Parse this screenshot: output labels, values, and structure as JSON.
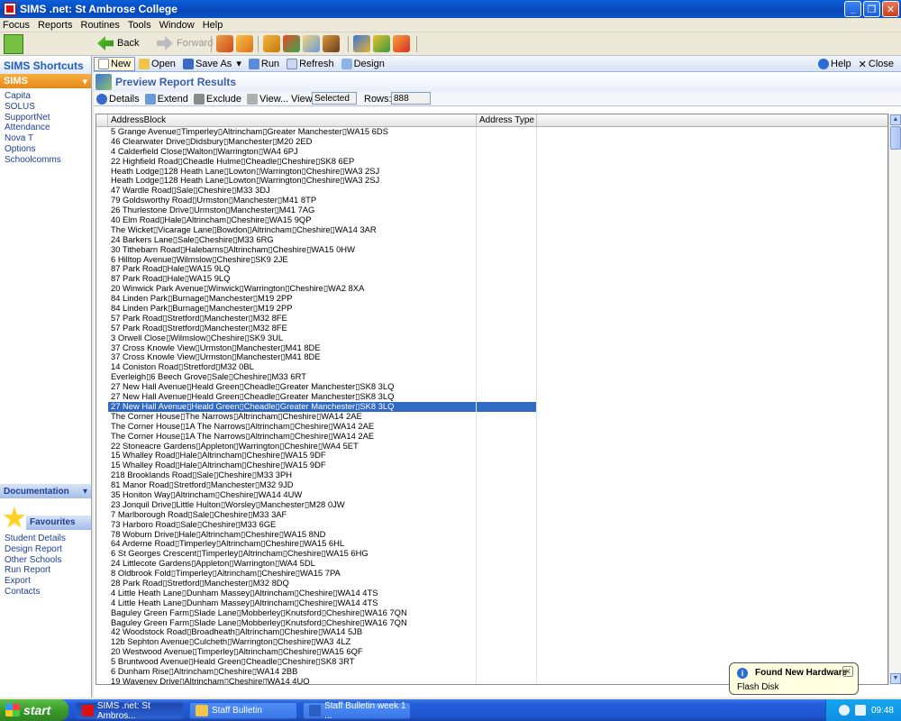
{
  "window": {
    "title": "SIMS .net: St Ambrose College"
  },
  "menu": [
    "Focus",
    "Reports",
    "Routines",
    "Tools",
    "Window",
    "Help"
  ],
  "toolbar": {
    "back": "Back",
    "forward": "Forward"
  },
  "sidebar": {
    "shortcuts_title": "SIMS Shortcuts",
    "group": "SIMS",
    "links": [
      "Capita",
      "SOLUS",
      "SupportNet",
      "Attendance",
      "Nova T",
      "Options",
      "Schoolcomms"
    ],
    "documentation": "Documentation",
    "favourites": "Favourites",
    "favourite_links": [
      "Student Details",
      "Design Report",
      "Other Schools",
      "Run Report",
      "Export",
      "Contacts"
    ]
  },
  "commands": {
    "new": "New",
    "open": "Open",
    "save_as": "Save As",
    "run": "Run",
    "refresh": "Refresh",
    "design": "Design",
    "help": "Help",
    "close": "Close"
  },
  "report": {
    "title": "Preview Report Results",
    "details": "Details",
    "extend": "Extend",
    "exclude": "Exclude",
    "view_menu": "View...",
    "view_label": "View:",
    "view_value": "Selected",
    "rows_label": "Rows:",
    "rows_value": "888"
  },
  "grid": {
    "columns": [
      "AddressBlock",
      "Address Type"
    ],
    "selected_index": 28,
    "rows": [
      "5 Grange Avenue▯Timperley▯Altrincham▯Greater Manchester▯WA15 6DS",
      "46 Clearwater Drive▯Didsbury▯Manchester▯M20 2ED",
      "4 Calderfield Close▯Walton▯Warrington▯WA4 6PJ",
      "22 Highfield Road▯Cheadle Hulme▯Cheadle▯Cheshire▯SK8 6EP",
      "Heath Lodge▯128 Heath Lane▯Lowton▯Warrington▯Cheshire▯WA3 2SJ",
      "Heath Lodge▯128 Heath Lane▯Lowton▯Warrington▯Cheshire▯WA3 2SJ",
      "47 Wardle Road▯Sale▯Cheshire▯M33 3DJ",
      "79 Goldsworthy Road▯Urmston▯Manchester▯M41 8TP",
      "26 Thurlestone Drive▯Urmston▯Manchester▯M41 7AG",
      "40 Elm Road▯Hale▯Altrincham▯Cheshire▯WA15 9QP",
      "The Wicket▯Vicarage Lane▯Bowdon▯Altrincham▯Cheshire▯WA14 3AR",
      "24 Barkers Lane▯Sale▯Cheshire▯M33 6RG",
      "30 Tithebarn Road▯Halebarns▯Altrincham▯Cheshire▯WA15 0HW",
      "6 Hilltop Avenue▯Wilmslow▯Cheshire▯SK9 2JE",
      "87 Park Road▯Hale▯WA15 9LQ",
      "87 Park Road▯Hale▯WA15 9LQ",
      "20 Winwick Park Avenue▯Winwick▯Warrington▯Cheshire▯WA2 8XA",
      "84 Linden Park▯Burnage▯Manchester▯M19 2PP",
      "84 Linden Park▯Burnage▯Manchester▯M19 2PP",
      "57 Park Road▯Stretford▯Manchester▯M32 8FE",
      "57 Park Road▯Stretford▯Manchester▯M32 8FE",
      "3 Orwell Close▯Wilmslow▯Cheshire▯SK9 3UL",
      "37 Cross Knowle View▯Urmston▯Manchester▯M41 8DE",
      "37 Cross Knowle View▯Urmston▯Manchester▯M41 8DE",
      "14 Coniston Road▯Stretford▯M32 0BL",
      "Everleigh▯6 Beech Grove▯Sale▯Cheshire▯M33 6RT",
      "27 New Hall Avenue▯Heald Green▯Cheadle▯Greater Manchester▯SK8 3LQ",
      "27 New Hall Avenue▯Heald Green▯Cheadle▯Greater Manchester▯SK8 3LQ",
      "27 New Hall Avenue▯Heald Green▯Cheadle▯Greater Manchester▯SK8 3LQ",
      "The Corner House▯The Narrows▯Altrincham▯Cheshire▯WA14 2AE",
      "The Corner House▯1A The Narrows▯Altrincham▯Cheshire▯WA14 2AE",
      "The Corner House▯1A The Narrows▯Altrincham▯Cheshire▯WA14 2AE",
      "22 Stoneacre Gardens▯Appleton▯Warrington▯Cheshire▯WA4 5ET",
      "15 Whalley Road▯Hale▯Altrincham▯Cheshire▯WA15 9DF",
      "15 Whalley Road▯Hale▯Altrincham▯Cheshire▯WA15 9DF",
      "218 Brooklands Road▯Sale▯Cheshire▯M33 3PH",
      "81 Manor Road▯Stretford▯Manchester▯M32 9JD",
      "35 Honiton Way▯Altrincham▯Cheshire▯WA14 4UW",
      "23 Jonquil Drive▯Little Hulton▯Worsley▯Manchester▯M28 0JW",
      "7 Marlborough Road▯Sale▯Cheshire▯M33 3AF",
      "73 Harboro Road▯Sale▯Cheshire▯M33 6GE",
      "78 Woburn Drive▯Hale▯Altrincham▯Cheshire▯WA15 8ND",
      "64 Arderne Road▯Timperley▯Altrincham▯Cheshire▯WA15 6HL",
      "6 St Georges Crescent▯Timperley▯Altrincham▯Cheshire▯WA15 6HG",
      "24 Littlecote Gardens▯Appleton▯Warrington▯WA4 5DL",
      "8 Oldbrook Fold▯Timperley▯Altrincham▯Cheshire▯WA15 7PA",
      "28 Park Road▯Stretford▯Manchester▯M32 8DQ",
      "4 Little Heath Lane▯Dunham Massey▯Altrincham▯Cheshire▯WA14 4TS",
      "4 Little Heath Lane▯Dunham Massey▯Altrincham▯Cheshire▯WA14 4TS",
      "Baguley Green Farm▯Slade Lane▯Mobberley▯Knutsford▯Cheshire▯WA16 7QN",
      "Baguley Green Farm▯Slade Lane▯Mobberley▯Knutsford▯Cheshire▯WA16 7QN",
      "42 Woodstock Road▯Broadheath▯Altrincham▯Cheshire▯WA14 5JB",
      "12b Sephton Avenue▯Culcheth▯Warrington▯Cheshire▯WA3 4LZ",
      "20 Westwood Avenue▯Timperley▯Altrincham▯Cheshire▯WA15 6QF",
      "5 Bruntwood Avenue▯Heald Green▯Cheadle▯Cheshire▯SK8 3RT",
      "6 Dunham Rise▯Altrincham▯Cheshire▯WA14 2BB",
      "19 Waveney Drive▯Altrincham▯Cheshire▯WA14 4UQ",
      "19 Waveney Drive▯Altrincham▯Cheshire▯WA14 4UQ"
    ]
  },
  "taskbar": {
    "start": "start",
    "tasks": [
      "SIMS .net: St Ambros...",
      "Staff Bulletin",
      "Staff Bulletin week 1 ..."
    ],
    "clock": "09:48"
  },
  "notification": {
    "title": "Found New Hardware",
    "message": "Flash Disk"
  },
  "colors": {
    "selection": "#316ac5",
    "title_bar": "#0a53c8",
    "link": "#1c3f94"
  }
}
